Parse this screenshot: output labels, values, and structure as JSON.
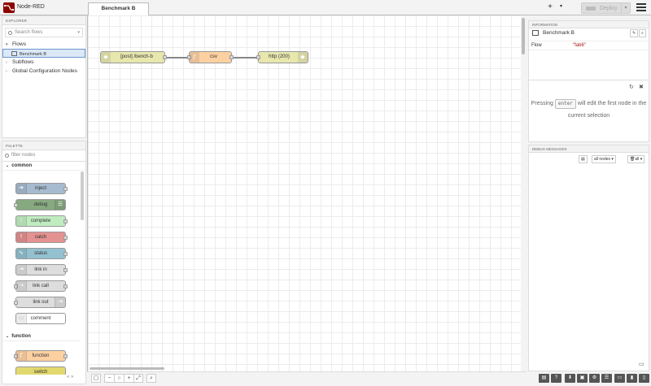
{
  "app": {
    "title": "Node-RED"
  },
  "header": {
    "deploy_label": "Deploy",
    "add_label": "+",
    "caret": "▾"
  },
  "explorer": {
    "heading": "EXPLORER",
    "search_placeholder": "Search flows",
    "tree": [
      {
        "label": "Flows",
        "toggle": "▾"
      },
      {
        "label": "Benchmark B",
        "selected": true
      },
      {
        "label": "Subflows",
        "toggle": "›"
      },
      {
        "label": "Global Configuration Nodes",
        "toggle": "›"
      }
    ]
  },
  "palette": {
    "heading": "PALETTE",
    "filter_placeholder": "filter nodes",
    "categories": [
      {
        "name": "common",
        "toggle": "⌄"
      },
      {
        "name": "function",
        "toggle": "⌄"
      }
    ],
    "nodes": [
      {
        "label": "inject",
        "color": "#a6bbcf"
      },
      {
        "label": "debug",
        "color": "#87a980"
      },
      {
        "label": "complete",
        "color": "#c0edc0"
      },
      {
        "label": "catch",
        "color": "#e49191"
      },
      {
        "label": "status",
        "color": "#94c1d0"
      },
      {
        "label": "link in",
        "color": "#dddddd"
      },
      {
        "label": "link call",
        "color": "#dddddd"
      },
      {
        "label": "link out",
        "color": "#dddddd"
      },
      {
        "label": "comment",
        "color": "#ffffff"
      },
      {
        "label": "function",
        "color": "#fdd0a2"
      },
      {
        "label": "switch",
        "color": "#e2d96e"
      }
    ]
  },
  "workspace": {
    "tab_label": "Benchmark B",
    "flow_nodes": [
      {
        "label": "[post] /bench-b",
        "color": "#e7e7ae"
      },
      {
        "label": "csv",
        "color": "#fdd0a2"
      },
      {
        "label": "http (200)",
        "color": "#e7e7ae"
      }
    ],
    "footer_buttons": [
      "▢",
      "−",
      "○",
      "+",
      "⤢",
      "⌕"
    ]
  },
  "info": {
    "heading": "INFORMATION",
    "title": "Benchmark B",
    "property_label": "Flow",
    "property_value": "\"fab6\"",
    "tip_before": "Pressing",
    "tip_key": "enter",
    "tip_after": "will edit the first node in the current selection"
  },
  "debug": {
    "heading": "DEBUG MESSAGES",
    "filter_label": "all nodes",
    "clear_label": "all"
  }
}
